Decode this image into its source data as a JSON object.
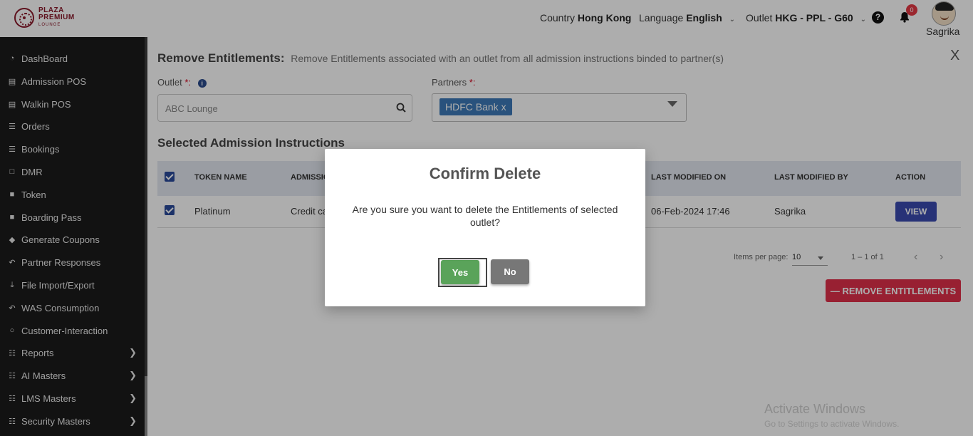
{
  "brand": {
    "line1": "PLAZA",
    "line2": "PREMIUM",
    "line3": "LOUNGE"
  },
  "header": {
    "country_label": "Country",
    "country_value": "Hong Kong",
    "language_label": "Language",
    "language_value": "English",
    "outlet_label": "Outlet",
    "outlet_value": "HKG - PPL - G60",
    "help_glyph": "?",
    "notification_count": "0",
    "user_name": "Sagrika"
  },
  "sidebar": {
    "items": [
      {
        "label": "DashBoard",
        "icon": "dashboard-icon"
      },
      {
        "label": "Admission POS",
        "icon": "id-card-icon"
      },
      {
        "label": "Walkin POS",
        "icon": "id-card-icon"
      },
      {
        "label": "Orders",
        "icon": "cart-icon"
      },
      {
        "label": "Bookings",
        "icon": "cart-icon"
      },
      {
        "label": "DMR",
        "icon": "calendar-icon"
      },
      {
        "label": "Token",
        "icon": "file-icon"
      },
      {
        "label": "Boarding Pass",
        "icon": "file-icon"
      },
      {
        "label": "Generate Coupons",
        "icon": "tag-icon"
      },
      {
        "label": "Partner Responses",
        "icon": "reply-icon"
      },
      {
        "label": "File Import/Export",
        "icon": "download-icon"
      },
      {
        "label": "WAS Consumption",
        "icon": "reply-icon"
      },
      {
        "label": "Customer-Interaction",
        "icon": "chat-icon"
      },
      {
        "label": "Reports",
        "icon": "sitemap-icon",
        "has_submenu": true
      },
      {
        "label": "AI Masters",
        "icon": "sitemap-icon",
        "has_submenu": true
      },
      {
        "label": "LMS Masters",
        "icon": "sitemap-icon",
        "has_submenu": true
      },
      {
        "label": "Security Masters",
        "icon": "sitemap-icon",
        "has_submenu": true
      }
    ]
  },
  "page": {
    "title": "Remove Entitlements:",
    "subtitle": "Remove Entitlements associated with an outlet from all admission instructions binded to partner(s)",
    "close_glyph": "X",
    "outlet_label": "Outlet",
    "outlet_required": "*:",
    "outlet_value": "ABC Lounge",
    "partners_label": "Partners",
    "partners_required": "*:",
    "partner_chip": "HDFC Bank x",
    "section_title": "Selected Admission Instructions"
  },
  "table": {
    "headers": [
      "TOKEN NAME",
      "ADMISSION",
      "LAST MODIFIED ON",
      "LAST MODIFIED BY",
      "ACTION"
    ],
    "rows": [
      {
        "token_name": "Platinum",
        "admission": "Credit ca",
        "last_modified_on": "06-Feb-2024 17:46",
        "last_modified_by": "Sagrika",
        "action": "VIEW"
      }
    ]
  },
  "pagination": {
    "items_per_page_label": "Items per page:",
    "items_per_page_value": "10",
    "range": "1 – 1 of 1",
    "prev_glyph": "‹",
    "next_glyph": "›"
  },
  "remove_button": "REMOVE ENTITLEMENTS",
  "watermark": {
    "line1": "Activate Windows",
    "line2": "Go to Settings to activate Windows."
  },
  "modal": {
    "title": "Confirm Delete",
    "message": "Are you sure you want to delete the Entitlements of selected outlet?",
    "yes": "Yes",
    "no": "No"
  }
}
